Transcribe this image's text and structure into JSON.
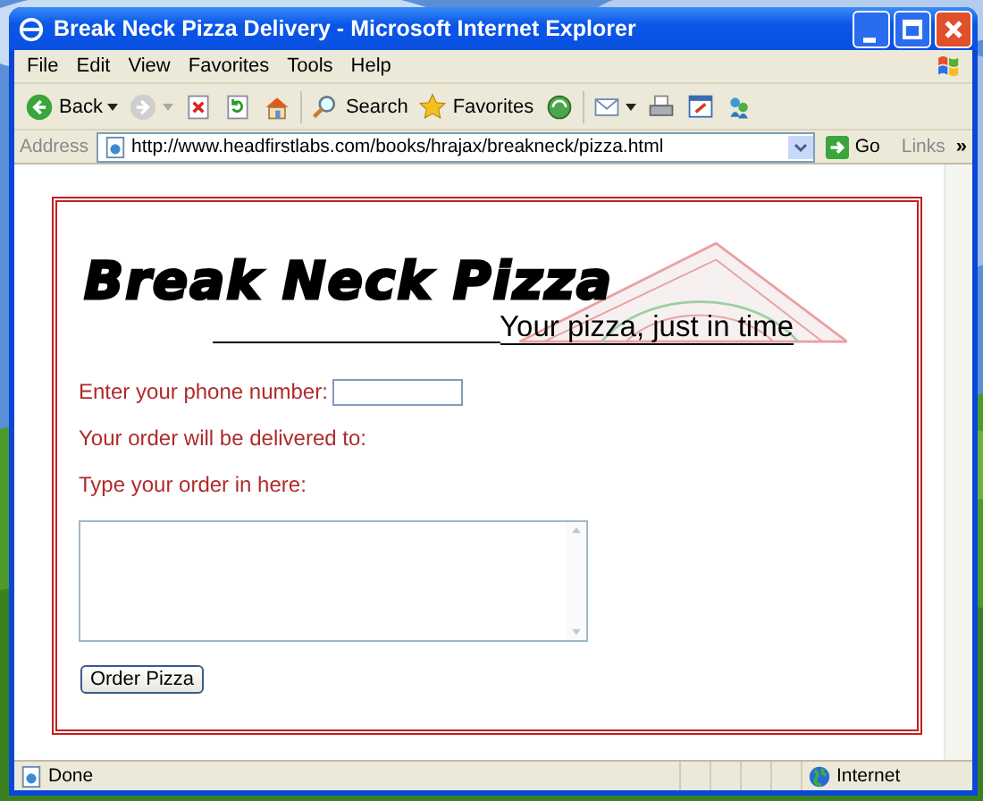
{
  "window": {
    "title": "Break Neck Pizza Delivery - Microsoft Internet Explorer"
  },
  "menu": [
    "File",
    "Edit",
    "View",
    "Favorites",
    "Tools",
    "Help"
  ],
  "toolbar": [
    {
      "kind": "back",
      "label": "Back"
    },
    {
      "kind": "forward"
    },
    {
      "kind": "stop"
    },
    {
      "kind": "refresh"
    },
    {
      "kind": "home"
    },
    {
      "kind": "search",
      "label": "Search"
    },
    {
      "kind": "favorites",
      "label": "Favorites"
    },
    {
      "kind": "media"
    },
    {
      "kind": "mail"
    },
    {
      "kind": "print"
    },
    {
      "kind": "edit"
    },
    {
      "kind": "messenger"
    }
  ],
  "address_bar": {
    "label": "Address",
    "url": "http://www.headfirstlabs.com/books/hrajax/breakneck/pizza.html",
    "go": "Go",
    "links": "Links",
    "more": "»"
  },
  "page": {
    "logo": "Break Neck Pizza",
    "tagline": "Your pizza, just in time",
    "phone_label": "Enter your phone number:",
    "delivery_label": "Your order will be delivered to:",
    "order_label": "Type your order in here:",
    "button": "Order Pizza"
  },
  "status_bar": {
    "text": "Done",
    "zone": "Internet"
  }
}
